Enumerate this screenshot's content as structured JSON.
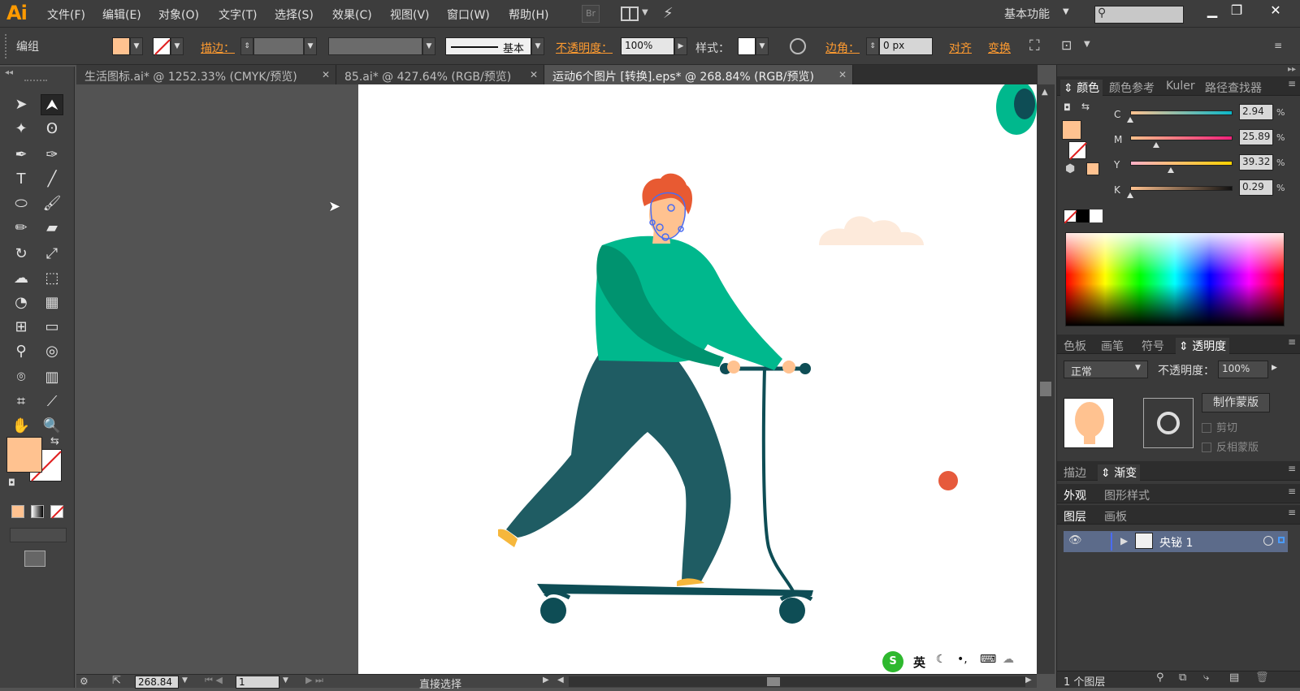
{
  "app": {
    "logo": "Ai"
  },
  "menu": [
    "文件(F)",
    "编辑(E)",
    "对象(O)",
    "文字(T)",
    "选择(S)",
    "效果(C)",
    "视图(V)",
    "窗口(W)",
    "帮助(H)"
  ],
  "bridge_label": "Br",
  "workspace": {
    "label": "基本功能"
  },
  "search": {
    "placeholder": ""
  },
  "control": {
    "group_label": "编组",
    "stroke_label": "描边：",
    "stroke_style": "基本",
    "opacity_label": "不透明度：",
    "opacity_value": "100%",
    "style_label": "样式：",
    "corner_label": "边角：",
    "corner_value": "0 px",
    "align_label": "对齐",
    "transform_label": "变换"
  },
  "colors": {
    "fill": "#ffc290",
    "accent_orange": "#ff9b30",
    "shirt": "#00b88d",
    "shirt_dark": "#00936f",
    "pants": "#1f5c63",
    "hair": "#e85a32",
    "skin": "#ffc290",
    "scooter": "#0e4d55",
    "shoe": "#f6b73c",
    "ball": "#e65a3c",
    "cloud": "#fdeadb"
  },
  "tabs": [
    {
      "label": "生活图标.ai* @ 1252.33% (CMYK/预览)",
      "active": false
    },
    {
      "label": "85.ai* @ 427.64% (RGB/预览)",
      "active": false
    },
    {
      "label": "运动6个图片 [转换].eps* @ 268.84% (RGB/预览)",
      "active": true
    }
  ],
  "color_panel": {
    "tabs": [
      "颜色",
      "颜色参考",
      "Kuler",
      "路径查找器"
    ],
    "channels": [
      {
        "label": "C",
        "value": "2.94"
      },
      {
        "label": "M",
        "value": "25.89"
      },
      {
        "label": "Y",
        "value": "39.32"
      },
      {
        "label": "K",
        "value": "0.29"
      }
    ],
    "percent": "%"
  },
  "transparency_panel": {
    "tabs": [
      "色板",
      "画笔",
      "符号",
      "透明度"
    ],
    "blend_mode": "正常",
    "opacity_label": "不透明度：",
    "opacity_value": "100%",
    "make_mask": "制作蒙版",
    "clip": "剪切",
    "invert_mask": "反相蒙版"
  },
  "gradient_panel": {
    "tabs": [
      "描边",
      "渐变"
    ]
  },
  "appearance_panel": {
    "tabs": [
      "外观",
      "图形样式"
    ]
  },
  "layers_panel": {
    "tabs": [
      "图层",
      "画板"
    ],
    "layer_name": "央铋 1",
    "footer_count": "1 个图层"
  },
  "status": {
    "zoom": "268.84",
    "page": "1",
    "tool": "直接选择"
  },
  "ime": {
    "lang": "英"
  }
}
